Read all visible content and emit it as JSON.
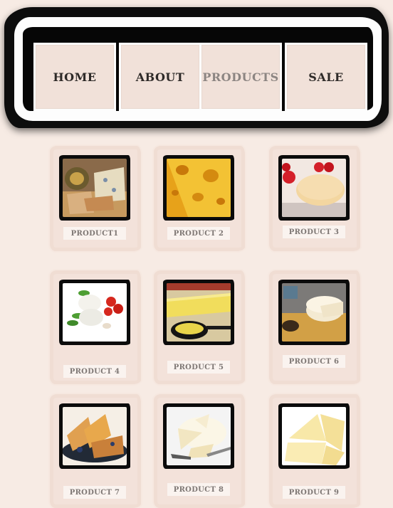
{
  "nav": {
    "items": [
      {
        "label": "HOME",
        "active": false
      },
      {
        "label": "ABOUT",
        "active": false
      },
      {
        "label": "PRODUCTS",
        "active": true
      },
      {
        "label": "SALE",
        "active": false
      }
    ]
  },
  "products": [
    {
      "label": "PRODUCT1",
      "icon": "cheese-board-image"
    },
    {
      "label": "PRODUCT 2",
      "icon": "swiss-cheese-image"
    },
    {
      "label": "PRODUCT 3",
      "icon": "cheese-strawberry-image"
    },
    {
      "label": "PRODUCT 4",
      "icon": "mozzarella-tomato-image"
    },
    {
      "label": "PRODUCT 5",
      "icon": "cheese-skillet-image"
    },
    {
      "label": "PRODUCT 6",
      "icon": "cheese-wheel-image"
    },
    {
      "label": "PRODUCT 7",
      "icon": "cheese-pasta-image"
    },
    {
      "label": "PRODUCT 8",
      "icon": "brie-knife-image"
    },
    {
      "label": "PRODUCT 9",
      "icon": "cheese-wedges-image"
    }
  ],
  "colors": {
    "background": "#f7ebe4",
    "nav_button": "#f1e1d9",
    "frame": "#0d0d0d",
    "label_text": "#7e7774",
    "active_nav_text": "#8c8582"
  }
}
